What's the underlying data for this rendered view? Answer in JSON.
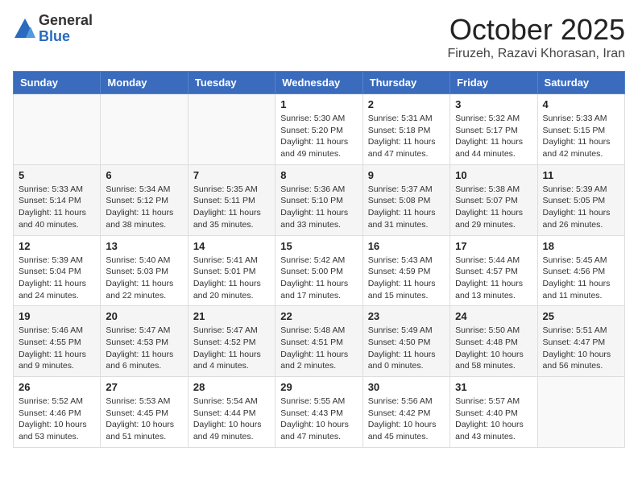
{
  "header": {
    "logo_general": "General",
    "logo_blue": "Blue",
    "month_title": "October 2025",
    "location": "Firuzeh, Razavi Khorasan, Iran"
  },
  "weekdays": [
    "Sunday",
    "Monday",
    "Tuesday",
    "Wednesday",
    "Thursday",
    "Friday",
    "Saturday"
  ],
  "weeks": [
    [
      {
        "day": "",
        "info": ""
      },
      {
        "day": "",
        "info": ""
      },
      {
        "day": "",
        "info": ""
      },
      {
        "day": "1",
        "info": "Sunrise: 5:30 AM\nSunset: 5:20 PM\nDaylight: 11 hours\nand 49 minutes."
      },
      {
        "day": "2",
        "info": "Sunrise: 5:31 AM\nSunset: 5:18 PM\nDaylight: 11 hours\nand 47 minutes."
      },
      {
        "day": "3",
        "info": "Sunrise: 5:32 AM\nSunset: 5:17 PM\nDaylight: 11 hours\nand 44 minutes."
      },
      {
        "day": "4",
        "info": "Sunrise: 5:33 AM\nSunset: 5:15 PM\nDaylight: 11 hours\nand 42 minutes."
      }
    ],
    [
      {
        "day": "5",
        "info": "Sunrise: 5:33 AM\nSunset: 5:14 PM\nDaylight: 11 hours\nand 40 minutes."
      },
      {
        "day": "6",
        "info": "Sunrise: 5:34 AM\nSunset: 5:12 PM\nDaylight: 11 hours\nand 38 minutes."
      },
      {
        "day": "7",
        "info": "Sunrise: 5:35 AM\nSunset: 5:11 PM\nDaylight: 11 hours\nand 35 minutes."
      },
      {
        "day": "8",
        "info": "Sunrise: 5:36 AM\nSunset: 5:10 PM\nDaylight: 11 hours\nand 33 minutes."
      },
      {
        "day": "9",
        "info": "Sunrise: 5:37 AM\nSunset: 5:08 PM\nDaylight: 11 hours\nand 31 minutes."
      },
      {
        "day": "10",
        "info": "Sunrise: 5:38 AM\nSunset: 5:07 PM\nDaylight: 11 hours\nand 29 minutes."
      },
      {
        "day": "11",
        "info": "Sunrise: 5:39 AM\nSunset: 5:05 PM\nDaylight: 11 hours\nand 26 minutes."
      }
    ],
    [
      {
        "day": "12",
        "info": "Sunrise: 5:39 AM\nSunset: 5:04 PM\nDaylight: 11 hours\nand 24 minutes."
      },
      {
        "day": "13",
        "info": "Sunrise: 5:40 AM\nSunset: 5:03 PM\nDaylight: 11 hours\nand 22 minutes."
      },
      {
        "day": "14",
        "info": "Sunrise: 5:41 AM\nSunset: 5:01 PM\nDaylight: 11 hours\nand 20 minutes."
      },
      {
        "day": "15",
        "info": "Sunrise: 5:42 AM\nSunset: 5:00 PM\nDaylight: 11 hours\nand 17 minutes."
      },
      {
        "day": "16",
        "info": "Sunrise: 5:43 AM\nSunset: 4:59 PM\nDaylight: 11 hours\nand 15 minutes."
      },
      {
        "day": "17",
        "info": "Sunrise: 5:44 AM\nSunset: 4:57 PM\nDaylight: 11 hours\nand 13 minutes."
      },
      {
        "day": "18",
        "info": "Sunrise: 5:45 AM\nSunset: 4:56 PM\nDaylight: 11 hours\nand 11 minutes."
      }
    ],
    [
      {
        "day": "19",
        "info": "Sunrise: 5:46 AM\nSunset: 4:55 PM\nDaylight: 11 hours\nand 9 minutes."
      },
      {
        "day": "20",
        "info": "Sunrise: 5:47 AM\nSunset: 4:53 PM\nDaylight: 11 hours\nand 6 minutes."
      },
      {
        "day": "21",
        "info": "Sunrise: 5:47 AM\nSunset: 4:52 PM\nDaylight: 11 hours\nand 4 minutes."
      },
      {
        "day": "22",
        "info": "Sunrise: 5:48 AM\nSunset: 4:51 PM\nDaylight: 11 hours\nand 2 minutes."
      },
      {
        "day": "23",
        "info": "Sunrise: 5:49 AM\nSunset: 4:50 PM\nDaylight: 11 hours\nand 0 minutes."
      },
      {
        "day": "24",
        "info": "Sunrise: 5:50 AM\nSunset: 4:48 PM\nDaylight: 10 hours\nand 58 minutes."
      },
      {
        "day": "25",
        "info": "Sunrise: 5:51 AM\nSunset: 4:47 PM\nDaylight: 10 hours\nand 56 minutes."
      }
    ],
    [
      {
        "day": "26",
        "info": "Sunrise: 5:52 AM\nSunset: 4:46 PM\nDaylight: 10 hours\nand 53 minutes."
      },
      {
        "day": "27",
        "info": "Sunrise: 5:53 AM\nSunset: 4:45 PM\nDaylight: 10 hours\nand 51 minutes."
      },
      {
        "day": "28",
        "info": "Sunrise: 5:54 AM\nSunset: 4:44 PM\nDaylight: 10 hours\nand 49 minutes."
      },
      {
        "day": "29",
        "info": "Sunrise: 5:55 AM\nSunset: 4:43 PM\nDaylight: 10 hours\nand 47 minutes."
      },
      {
        "day": "30",
        "info": "Sunrise: 5:56 AM\nSunset: 4:42 PM\nDaylight: 10 hours\nand 45 minutes."
      },
      {
        "day": "31",
        "info": "Sunrise: 5:57 AM\nSunset: 4:40 PM\nDaylight: 10 hours\nand 43 minutes."
      },
      {
        "day": "",
        "info": ""
      }
    ]
  ]
}
